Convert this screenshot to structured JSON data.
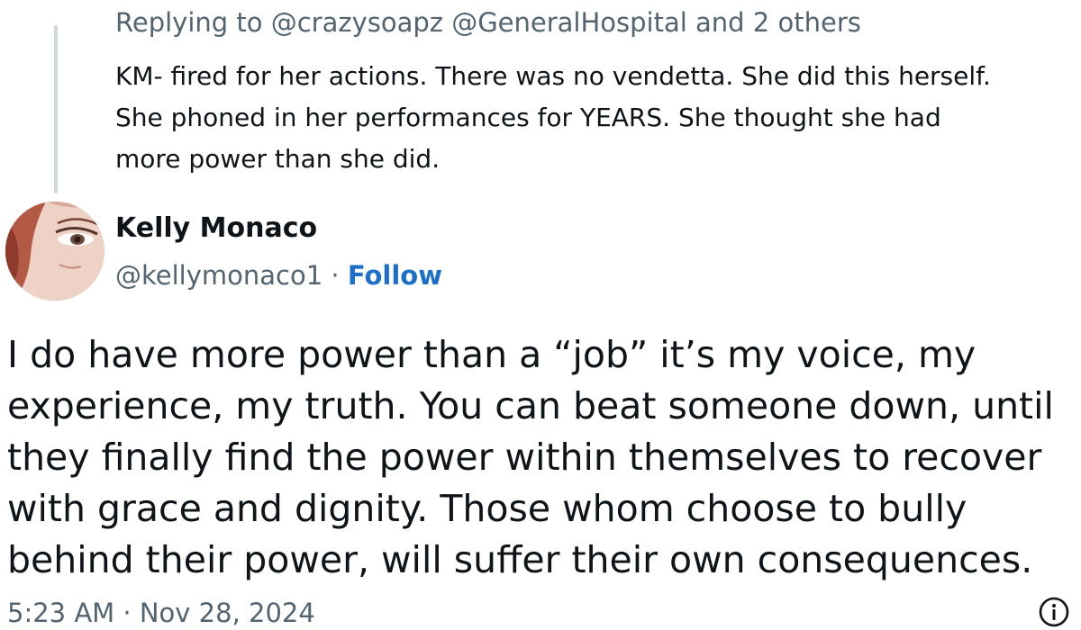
{
  "parent_tweet": {
    "replying_to": "Replying to @crazysoapz @GeneralHospital and 2 others",
    "text_lines": [
      "KM- fired for her actions. There was no vendetta. She did this herself.",
      "She phoned in her performances for YEARS. She thought she had",
      "more power than she did."
    ]
  },
  "author": {
    "name": "Kelly Monaco",
    "handle": "@kellymonaco1",
    "separator": " · ",
    "follow_label": "Follow"
  },
  "tweet": {
    "text_lines": [
      "I do have more power than a “job” it’s my voice, my",
      "experience, my truth. You can beat someone down, until",
      "they finally find the power within themselves to recover",
      "with grace and dignity. Those whom choose to bully",
      "behind their power, will suffer their own consequences."
    ],
    "timestamp": "5:23 AM · Nov 28, 2024"
  },
  "icons": {
    "info": "info-icon",
    "avatar": "avatar"
  },
  "colors": {
    "text_primary": "#0f1419",
    "text_secondary": "#536471",
    "link": "#1d6fc9",
    "thread_line": "#cfd9de"
  }
}
